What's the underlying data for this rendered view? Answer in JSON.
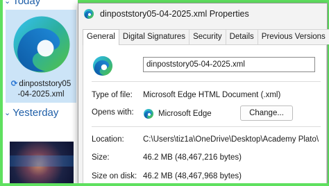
{
  "explorer": {
    "group_today": "Today",
    "group_yesterday": "Yesterday",
    "file_name_line1": "dinpoststory05",
    "file_name_line2": "-04-2025.xml",
    "sync_icon": "sync-icon",
    "file_icon": "edge-icon"
  },
  "dialog": {
    "title": "dinpoststory05-04-2025.xml Properties",
    "tabs": [
      {
        "label": "General",
        "active": true
      },
      {
        "label": "Digital Signatures"
      },
      {
        "label": "Security"
      },
      {
        "label": "Details"
      },
      {
        "label": "Previous Versions"
      }
    ],
    "name_value": "dinpoststory05-04-2025.xml",
    "type_label": "Type of file:",
    "type_value": "Microsoft Edge HTML Document (.xml)",
    "opens_label": "Opens with:",
    "opens_value": "Microsoft Edge",
    "change_button": "Change...",
    "location_label": "Location:",
    "location_value": "C:\\Users\\tiz1a\\OneDrive\\Desktop\\Academy Plato\\",
    "size_label": "Size:",
    "size_value": "46.2 MB (48,467,216 bytes)",
    "disk_label": "Size on disk:",
    "disk_value": "46.2 MB (48,467,968 bytes)"
  },
  "colors": {
    "accent": "#1f5fa8",
    "selection": "#cce4f7",
    "frame": "#5fe05f"
  }
}
